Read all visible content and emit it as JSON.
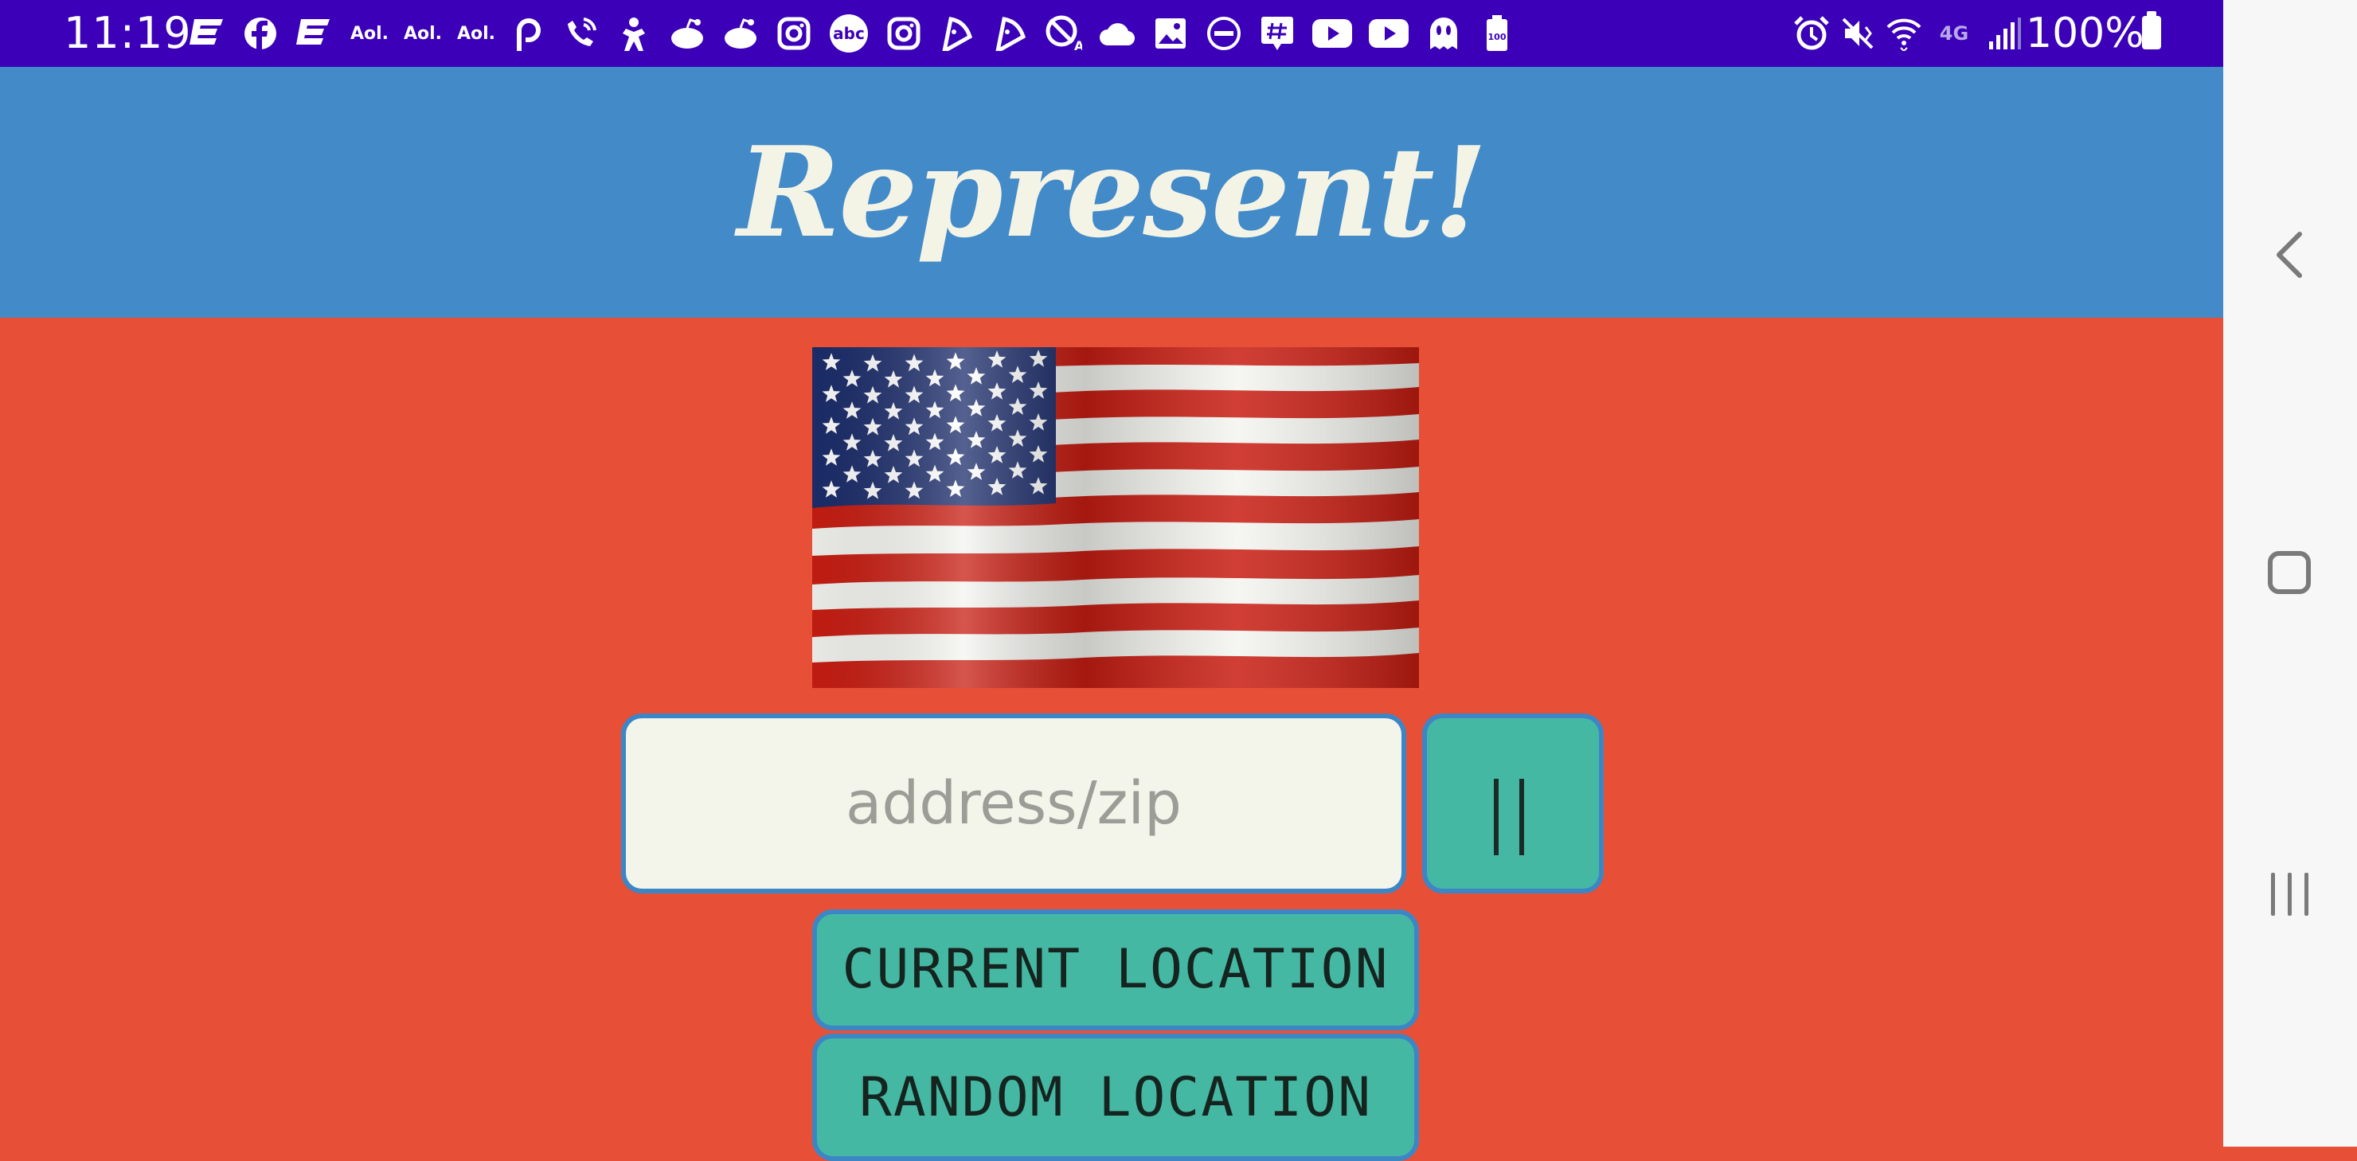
{
  "status_bar": {
    "time": "11:19",
    "notification_icons": [
      "yahoo-e-icon",
      "facebook-icon",
      "yahoo-e-icon",
      "aol-icon",
      "aol-icon",
      "aol-icon",
      "p-icon",
      "wifi-call-icon",
      "person-icon",
      "reddit-icon",
      "reddit-icon",
      "instagram-icon",
      "abc-icon",
      "instagram-icon",
      "pizza-icon",
      "pizza-icon",
      "no-alert-icon",
      "cloud-icon",
      "image-icon",
      "minus-circle-icon",
      "hashtag-chat-icon",
      "youtube-icon",
      "youtube-icon",
      "ghost-icon",
      "battery-100-icon"
    ],
    "aol_label": "Aol.",
    "abc_label": "abc",
    "battery_small_label": "100",
    "network_label": "4G",
    "battery_percent": "100%",
    "color": "#3b00b8"
  },
  "header": {
    "title": "Represent!",
    "color": "#428ac8"
  },
  "main": {
    "background_color": "#e74f37",
    "flag_icon": "american-flag",
    "address_input": {
      "placeholder": "address/zip",
      "value": ""
    },
    "search_button_icon": "pause-bars-icon",
    "current_location_label": "CURRENT LOCATION",
    "random_location_label": "RANDOM LOCATION",
    "button_color": "#45b8a4",
    "button_border_color": "#3d86c6"
  },
  "nav_bar": {
    "icons": [
      "back-icon",
      "home-icon",
      "recents-icon"
    ]
  }
}
